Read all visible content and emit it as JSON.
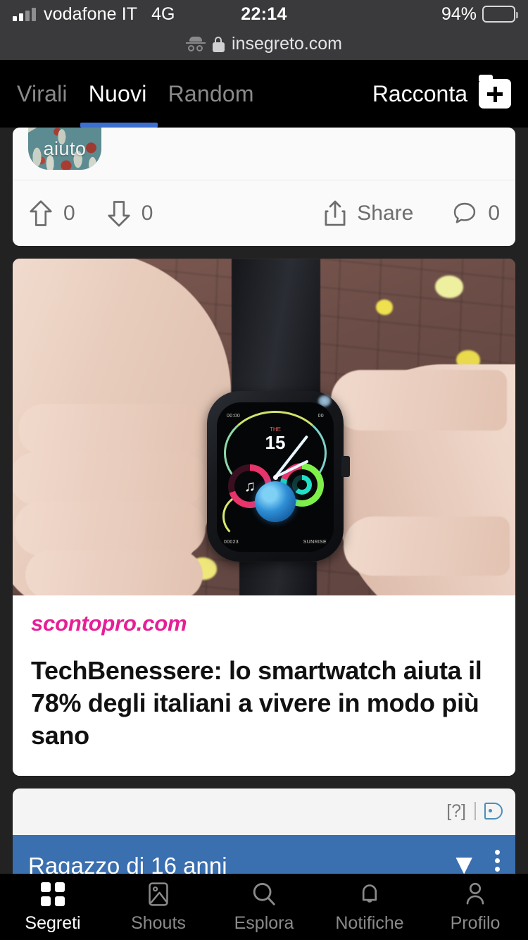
{
  "status_bar": {
    "carrier": "vodafone IT",
    "network": "4G",
    "time": "22:14",
    "battery_percent": "94%",
    "signal_icon": "signal-bars-icon",
    "battery_icon": "battery-icon"
  },
  "browser": {
    "url": "insegreto.com",
    "incognito_icon": "incognito-icon",
    "lock_icon": "lock-icon"
  },
  "top_nav": {
    "tabs": [
      {
        "label": "Virali",
        "active": false
      },
      {
        "label": "Nuovi",
        "active": true
      },
      {
        "label": "Random",
        "active": false
      }
    ],
    "compose_label": "Racconta",
    "compose_icon": "add-post-icon",
    "active_underline_color": "#3c6fd0"
  },
  "feed": {
    "partial_post": {
      "avatar_label": "aiuto",
      "avatar_icon": "hands-hearts-avatar",
      "upvote_icon": "upvote-arrow-icon",
      "upvote_count": "0",
      "downvote_icon": "downvote-arrow-icon",
      "downvote_count": "0",
      "share_icon": "share-icon",
      "share_label": "Share",
      "comment_icon": "comment-bubble-icon",
      "comment_count": "0"
    },
    "ad_card": {
      "image_alt": "hand-holding-smartwatch-photo",
      "watch_face_date": "15",
      "watch_face_note_icon": "music-note-icon",
      "domain": "scontopro.com",
      "domain_color": "#e61f96",
      "title": "TechBenessere: lo smartwatch aiuta il 78% degli italiani a vivere in modo più sano"
    },
    "banner_ad": {
      "info_label": "[?]",
      "adchoices_icon": "adchoices-icon",
      "headline": "Ragazzo di 16 anni",
      "star_icon": "star-icon",
      "menu_icon": "overflow-menu-icon",
      "bar_color": "#3a6fb0"
    }
  },
  "bottom_nav": {
    "items": [
      {
        "label": "Segreti",
        "icon": "grid-squares-icon",
        "active": true
      },
      {
        "label": "Shouts",
        "icon": "image-photo-icon",
        "active": false
      },
      {
        "label": "Esplora",
        "icon": "search-icon",
        "active": false
      },
      {
        "label": "Notifiche",
        "icon": "bell-icon",
        "active": false
      },
      {
        "label": "Profilo",
        "icon": "person-icon",
        "active": false
      }
    ]
  }
}
